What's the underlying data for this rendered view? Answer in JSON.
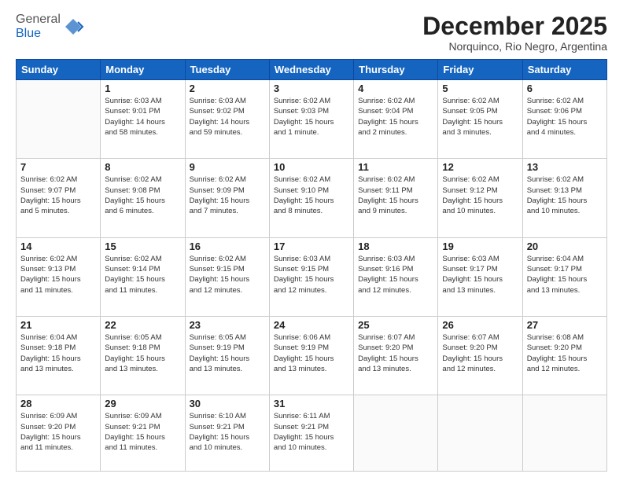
{
  "header": {
    "logo_general": "General",
    "logo_blue": "Blue",
    "month_title": "December 2025",
    "location": "Norquinco, Rio Negro, Argentina"
  },
  "days_of_week": [
    "Sunday",
    "Monday",
    "Tuesday",
    "Wednesday",
    "Thursday",
    "Friday",
    "Saturday"
  ],
  "weeks": [
    [
      {
        "day": "",
        "info": ""
      },
      {
        "day": "1",
        "info": "Sunrise: 6:03 AM\nSunset: 9:01 PM\nDaylight: 14 hours\nand 58 minutes."
      },
      {
        "day": "2",
        "info": "Sunrise: 6:03 AM\nSunset: 9:02 PM\nDaylight: 14 hours\nand 59 minutes."
      },
      {
        "day": "3",
        "info": "Sunrise: 6:02 AM\nSunset: 9:03 PM\nDaylight: 15 hours\nand 1 minute."
      },
      {
        "day": "4",
        "info": "Sunrise: 6:02 AM\nSunset: 9:04 PM\nDaylight: 15 hours\nand 2 minutes."
      },
      {
        "day": "5",
        "info": "Sunrise: 6:02 AM\nSunset: 9:05 PM\nDaylight: 15 hours\nand 3 minutes."
      },
      {
        "day": "6",
        "info": "Sunrise: 6:02 AM\nSunset: 9:06 PM\nDaylight: 15 hours\nand 4 minutes."
      }
    ],
    [
      {
        "day": "7",
        "info": "Sunrise: 6:02 AM\nSunset: 9:07 PM\nDaylight: 15 hours\nand 5 minutes."
      },
      {
        "day": "8",
        "info": "Sunrise: 6:02 AM\nSunset: 9:08 PM\nDaylight: 15 hours\nand 6 minutes."
      },
      {
        "day": "9",
        "info": "Sunrise: 6:02 AM\nSunset: 9:09 PM\nDaylight: 15 hours\nand 7 minutes."
      },
      {
        "day": "10",
        "info": "Sunrise: 6:02 AM\nSunset: 9:10 PM\nDaylight: 15 hours\nand 8 minutes."
      },
      {
        "day": "11",
        "info": "Sunrise: 6:02 AM\nSunset: 9:11 PM\nDaylight: 15 hours\nand 9 minutes."
      },
      {
        "day": "12",
        "info": "Sunrise: 6:02 AM\nSunset: 9:12 PM\nDaylight: 15 hours\nand 10 minutes."
      },
      {
        "day": "13",
        "info": "Sunrise: 6:02 AM\nSunset: 9:13 PM\nDaylight: 15 hours\nand 10 minutes."
      }
    ],
    [
      {
        "day": "14",
        "info": "Sunrise: 6:02 AM\nSunset: 9:13 PM\nDaylight: 15 hours\nand 11 minutes."
      },
      {
        "day": "15",
        "info": "Sunrise: 6:02 AM\nSunset: 9:14 PM\nDaylight: 15 hours\nand 11 minutes."
      },
      {
        "day": "16",
        "info": "Sunrise: 6:02 AM\nSunset: 9:15 PM\nDaylight: 15 hours\nand 12 minutes."
      },
      {
        "day": "17",
        "info": "Sunrise: 6:03 AM\nSunset: 9:15 PM\nDaylight: 15 hours\nand 12 minutes."
      },
      {
        "day": "18",
        "info": "Sunrise: 6:03 AM\nSunset: 9:16 PM\nDaylight: 15 hours\nand 12 minutes."
      },
      {
        "day": "19",
        "info": "Sunrise: 6:03 AM\nSunset: 9:17 PM\nDaylight: 15 hours\nand 13 minutes."
      },
      {
        "day": "20",
        "info": "Sunrise: 6:04 AM\nSunset: 9:17 PM\nDaylight: 15 hours\nand 13 minutes."
      }
    ],
    [
      {
        "day": "21",
        "info": "Sunrise: 6:04 AM\nSunset: 9:18 PM\nDaylight: 15 hours\nand 13 minutes."
      },
      {
        "day": "22",
        "info": "Sunrise: 6:05 AM\nSunset: 9:18 PM\nDaylight: 15 hours\nand 13 minutes."
      },
      {
        "day": "23",
        "info": "Sunrise: 6:05 AM\nSunset: 9:19 PM\nDaylight: 15 hours\nand 13 minutes."
      },
      {
        "day": "24",
        "info": "Sunrise: 6:06 AM\nSunset: 9:19 PM\nDaylight: 15 hours\nand 13 minutes."
      },
      {
        "day": "25",
        "info": "Sunrise: 6:07 AM\nSunset: 9:20 PM\nDaylight: 15 hours\nand 13 minutes."
      },
      {
        "day": "26",
        "info": "Sunrise: 6:07 AM\nSunset: 9:20 PM\nDaylight: 15 hours\nand 12 minutes."
      },
      {
        "day": "27",
        "info": "Sunrise: 6:08 AM\nSunset: 9:20 PM\nDaylight: 15 hours\nand 12 minutes."
      }
    ],
    [
      {
        "day": "28",
        "info": "Sunrise: 6:09 AM\nSunset: 9:20 PM\nDaylight: 15 hours\nand 11 minutes."
      },
      {
        "day": "29",
        "info": "Sunrise: 6:09 AM\nSunset: 9:21 PM\nDaylight: 15 hours\nand 11 minutes."
      },
      {
        "day": "30",
        "info": "Sunrise: 6:10 AM\nSunset: 9:21 PM\nDaylight: 15 hours\nand 10 minutes."
      },
      {
        "day": "31",
        "info": "Sunrise: 6:11 AM\nSunset: 9:21 PM\nDaylight: 15 hours\nand 10 minutes."
      },
      {
        "day": "",
        "info": ""
      },
      {
        "day": "",
        "info": ""
      },
      {
        "day": "",
        "info": ""
      }
    ]
  ]
}
